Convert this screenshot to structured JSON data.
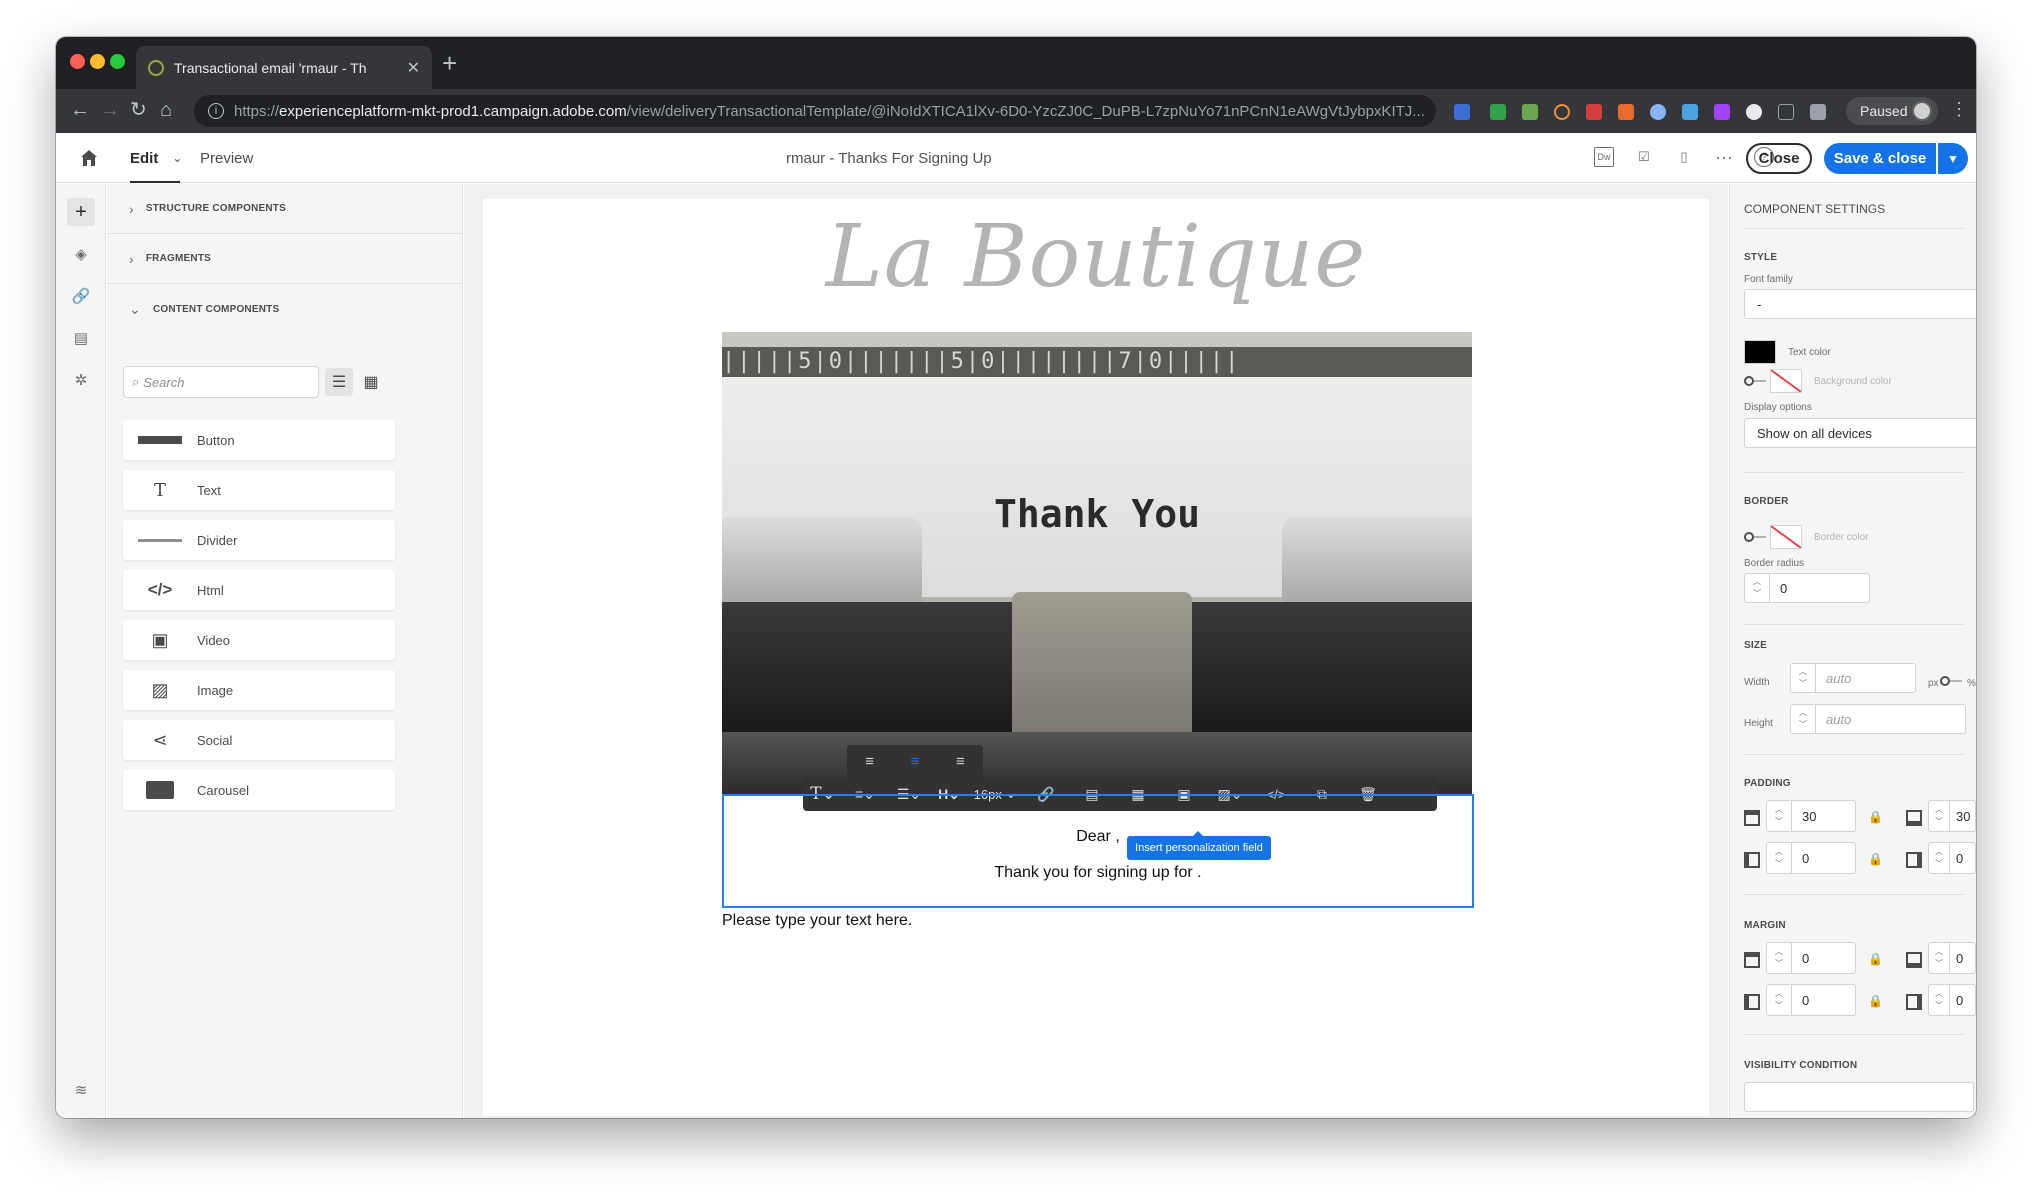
{
  "browser": {
    "tab_title": "Transactional email 'rmaur - Th",
    "url_scheme": "https://",
    "url_host": "experienceplatform-mkt-prod1.campaign.adobe.com",
    "url_path": "/view/deliveryTransactionalTemplate/@iNoIdXTICA1lXv-6D0-YzcZJ0C_DuPB-L7zpNuYo71nPCnN1eAWgVtJybpxKITJ...",
    "profile_status": "Paused"
  },
  "header": {
    "tab_edit": "Edit",
    "tab_preview": "Preview",
    "doc_title": "rmaur - Thanks For Signing Up",
    "close_label": "Close",
    "save_label": "Save & close",
    "accent_color": "#1473e6"
  },
  "components_panel": {
    "sections": [
      "STRUCTURE COMPONENTS",
      "FRAGMENTS",
      "CONTENT COMPONENTS"
    ],
    "search_placeholder": "Search",
    "items": [
      {
        "label": "Button",
        "icon": "button-icon"
      },
      {
        "label": "Text",
        "icon": "text-icon"
      },
      {
        "label": "Divider",
        "icon": "divider-icon"
      },
      {
        "label": "Html",
        "icon": "code-icon"
      },
      {
        "label": "Video",
        "icon": "video-icon"
      },
      {
        "label": "Image",
        "icon": "image-icon"
      },
      {
        "label": "Social",
        "icon": "share-icon"
      },
      {
        "label": "Carousel",
        "icon": "carousel-icon"
      }
    ]
  },
  "email": {
    "logo_text": "La Boutique",
    "hero_text": "Thank You",
    "hero_ticks": "|||||5|0|||||||5|0||||||||7|0|||||",
    "line1": "Dear ,",
    "line2": "Thank you for signing up for .",
    "placeholder": "Please type your text here.",
    "toolbar_font_size": "16px",
    "toolbar_heading": "H",
    "tooltip": "Insert personalization field"
  },
  "settings": {
    "title": "COMPONENT SETTINGS",
    "style_head": "STYLE",
    "font_family_label": "Font family",
    "font_family_value": "-",
    "text_color_label": "Text color",
    "text_color": "#000000",
    "bg_color_label": "Background color",
    "display_options_label": "Display options",
    "display_options_value": "Show on all devices",
    "border_head": "BORDER",
    "border_color_label": "Border color",
    "border_radius_label": "Border radius",
    "border_radius_value": "0",
    "size_head": "SIZE",
    "width_label": "Width",
    "width_placeholder": "auto",
    "height_label": "Height",
    "height_placeholder": "auto",
    "unit_px": "px",
    "unit_pct": "%",
    "padding_head": "PADDING",
    "padding": {
      "top": "30",
      "bottom": "30",
      "left": "0",
      "right": "0"
    },
    "margin_head": "MARGIN",
    "margin": {
      "top": "0",
      "bottom": "0",
      "left": "0",
      "right": "0"
    },
    "visibility_head": "VISIBILITY CONDITION"
  }
}
